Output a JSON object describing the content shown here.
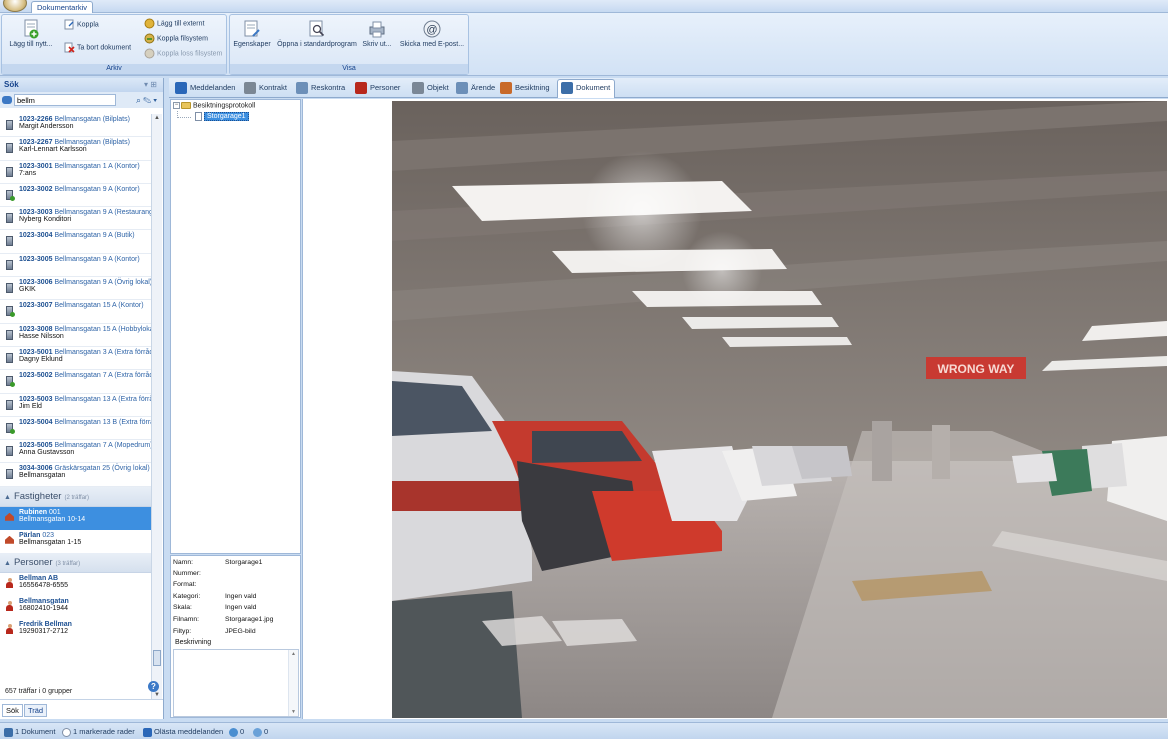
{
  "app": {
    "tab": "Dokumentarkiv"
  },
  "ribbon": {
    "arkiv": {
      "caption": "Arkiv",
      "add_new": "Lägg till nytt...",
      "koppla": "Koppla",
      "remove_doc": "Ta bort dokument",
      "add_external": "Lägg till externt",
      "link_filesystem": "Koppla filsystem",
      "unlink_filesystem": "Koppla loss filsystem"
    },
    "visa": {
      "caption": "Visa",
      "properties": "Egenskaper",
      "open_default": "Öppna i standardprogram",
      "print": "Skriv ut...",
      "send_email": "Skicka med E-post..."
    }
  },
  "search": {
    "title": "Sök",
    "query": "bellm",
    "results": [
      {
        "id": "1023-2266",
        "addr": "Bellmansgatan (Bilplats)",
        "sub": "Margit Andersson",
        "icon": "gray"
      },
      {
        "id": "1023-2267",
        "addr": "Bellmansgatan (Bilplats)",
        "sub": "Karl-Lennart Karlsson",
        "icon": "gray"
      },
      {
        "id": "1023-3001",
        "addr": "Bellmansgatan 1 A (Kontor)",
        "sub": "7:ans",
        "icon": "gray"
      },
      {
        "id": "1023-3002",
        "addr": "Bellmansgatan 9 A (Kontor)",
        "sub": "",
        "icon": "green"
      },
      {
        "id": "1023-3003",
        "addr": "Bellmansgatan 9 A (Restaurang)",
        "sub": "Nyberg Konditori",
        "icon": "gray"
      },
      {
        "id": "1023-3004",
        "addr": "Bellmansgatan 9 A (Butik)",
        "sub": "",
        "icon": "gray"
      },
      {
        "id": "1023-3005",
        "addr": "Bellmansgatan 9 A (Kontor)",
        "sub": "",
        "icon": "gray"
      },
      {
        "id": "1023-3006",
        "addr": "Bellmansgatan 9 A (Övrig lokal)",
        "sub": "GKIK",
        "icon": "gray"
      },
      {
        "id": "1023-3007",
        "addr": "Bellmansgatan 15 A (Kontor)",
        "sub": "",
        "icon": "green"
      },
      {
        "id": "1023-3008",
        "addr": "Bellmansgatan 15 A (Hobbylokal)",
        "sub": "Hasse Nilsson",
        "icon": "gray"
      },
      {
        "id": "1023-5001",
        "addr": "Bellmansgatan 3 A (Extra förråd)",
        "sub": "Dagny Eklund",
        "icon": "gray"
      },
      {
        "id": "1023-5002",
        "addr": "Bellmansgatan 7 A (Extra förråd)",
        "sub": "",
        "icon": "green"
      },
      {
        "id": "1023-5003",
        "addr": "Bellmansgatan 13 A (Extra förråd)",
        "sub": "Jim Eld",
        "icon": "gray"
      },
      {
        "id": "1023-5004",
        "addr": "Bellmansgatan 13 B (Extra förråd)",
        "sub": "",
        "icon": "green"
      },
      {
        "id": "1023-5005",
        "addr": "Bellmansgatan 7 A (Mopedrum)",
        "sub": "Anna Gustavsson",
        "icon": "gray"
      },
      {
        "id": "3034-3006",
        "addr": "Gräskärsgatan 25 (Övrig lokal)",
        "sub": "Bellmansgatan",
        "icon": "gray"
      }
    ],
    "fastigheter": {
      "title": "Fastigheter",
      "hits": "(2 träffar)",
      "items": [
        {
          "id": "Rubinen",
          "num": "001",
          "sub": "Bellmansgatan 10-14"
        },
        {
          "id": "Pärlan",
          "num": "023",
          "sub": "Bellmansgatan 1-15"
        }
      ]
    },
    "personer": {
      "title": "Personer",
      "hits": "(3 träffar)",
      "items": [
        {
          "name": "Bellman AB",
          "sub": "16556478-6555"
        },
        {
          "name": "Bellmansgatan",
          "sub": "16802410-1944"
        },
        {
          "name": "Fredrik Bellman",
          "sub": "19290317-2712"
        }
      ]
    },
    "count_text": "657 träffar i 0 grupper",
    "tab_search": "Sök",
    "tab_tree": "Träd"
  },
  "tabs": [
    {
      "label": "Meddelanden",
      "color": "#2a67b8"
    },
    {
      "label": "Kontrakt",
      "color": "#7b8794"
    },
    {
      "label": "Reskontra",
      "color": "#6c8fb8"
    },
    {
      "label": "Personer",
      "color": "#b8281c"
    },
    {
      "label": "Objekt",
      "color": "#7a8796"
    },
    {
      "label": "Ärende",
      "color": "#6c8fb8"
    },
    {
      "label": "Besiktning",
      "color": "#c86a2a"
    },
    {
      "label": "Dokument",
      "color": "#3c6ea8"
    }
  ],
  "tree": {
    "root": "Besiktningsprotokoll",
    "child": "Storgarage1"
  },
  "properties": {
    "name_label": "Namn:",
    "name_value": "Storgarage1",
    "number_label": "Nummer:",
    "number_value": "",
    "format_label": "Format:",
    "format_value": "",
    "category_label": "Kategori:",
    "category_value": "Ingen vald",
    "scale_label": "Skala:",
    "scale_value": "Ingen vald",
    "filename_label": "Filnamn:",
    "filename_value": "Storgarage1.jpg",
    "filetype_label": "Filtyp:",
    "filetype_value": "JPEG-bild",
    "description_label": "Beskrivning"
  },
  "preview": {
    "sign_text": "WRONG WAY"
  },
  "status": {
    "documents": "1 Dokument",
    "marked_rows": "1 markerade rader",
    "unread": "Olästa meddelanden",
    "count_a": "0",
    "count_b": "0"
  }
}
